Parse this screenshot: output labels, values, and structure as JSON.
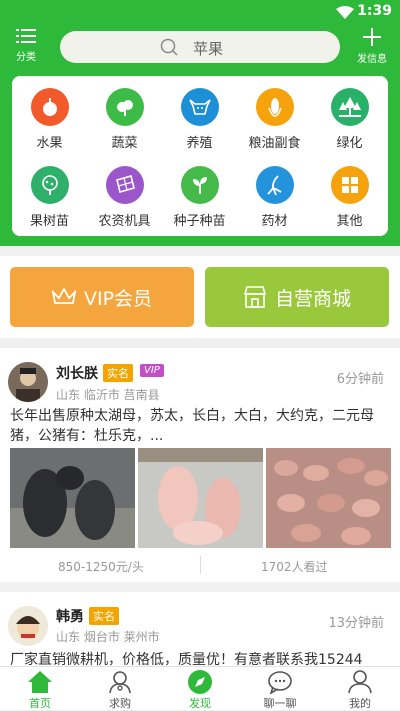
{
  "status": {
    "time": "1:39"
  },
  "header": {
    "category_label": "分类",
    "search_text": "苹果",
    "post_label": "发信息"
  },
  "categories": [
    {
      "label": "水果",
      "icon": "apple-icon",
      "color": "#f2592b"
    },
    {
      "label": "蔬菜",
      "icon": "vegetable-icon",
      "color": "#3dbb47"
    },
    {
      "label": "养殖",
      "icon": "cow-icon",
      "color": "#1d8fd6"
    },
    {
      "label": "粮油副食",
      "icon": "corn-icon",
      "color": "#f5a20c"
    },
    {
      "label": "绿化",
      "icon": "trees-icon",
      "color": "#29b069"
    },
    {
      "label": "果树苗",
      "icon": "fruit-tree-icon",
      "color": "#2fb06a"
    },
    {
      "label": "农资机具",
      "icon": "solar-panel-icon",
      "color": "#9b57c9"
    },
    {
      "label": "种子种苗",
      "icon": "sprout-icon",
      "color": "#45b94a"
    },
    {
      "label": "药材",
      "icon": "ginseng-icon",
      "color": "#2493dc"
    },
    {
      "label": "其他",
      "icon": "grid-icon",
      "color": "#f5a20c"
    }
  ],
  "promo": {
    "vip_label": "VIP会员",
    "vip_color": "#f5a53d",
    "store_label": "自营商城",
    "store_color": "#9ac83c"
  },
  "posts": [
    {
      "name": "刘长朕",
      "real_badge": "实名",
      "vip_badge": "VIP",
      "location": "山东 临沂市 莒南县",
      "time": "6分钟前",
      "content": "长年出售原种太湖母，苏太，长白，大白，大约克，二元母猪，公猪有：杜乐克，...",
      "price": "850-1250元/头",
      "views": "1702人看过"
    },
    {
      "name": "韩勇",
      "real_badge": "实名",
      "location": "山东 烟台市 莱州市",
      "time": "13分钟前",
      "content": "厂家直销微耕机，价格低，质量优！有意者联系我15244"
    }
  ],
  "tabs": [
    {
      "label": "首页",
      "icon": "home-icon",
      "active": true
    },
    {
      "label": "求购",
      "icon": "buy-request-icon",
      "active": false
    },
    {
      "label": "发现",
      "icon": "compass-icon",
      "active": true
    },
    {
      "label": "聊一聊",
      "icon": "chat-icon",
      "active": false
    },
    {
      "label": "我的",
      "icon": "profile-icon",
      "active": false
    }
  ],
  "accent_color": "#2fb93a"
}
